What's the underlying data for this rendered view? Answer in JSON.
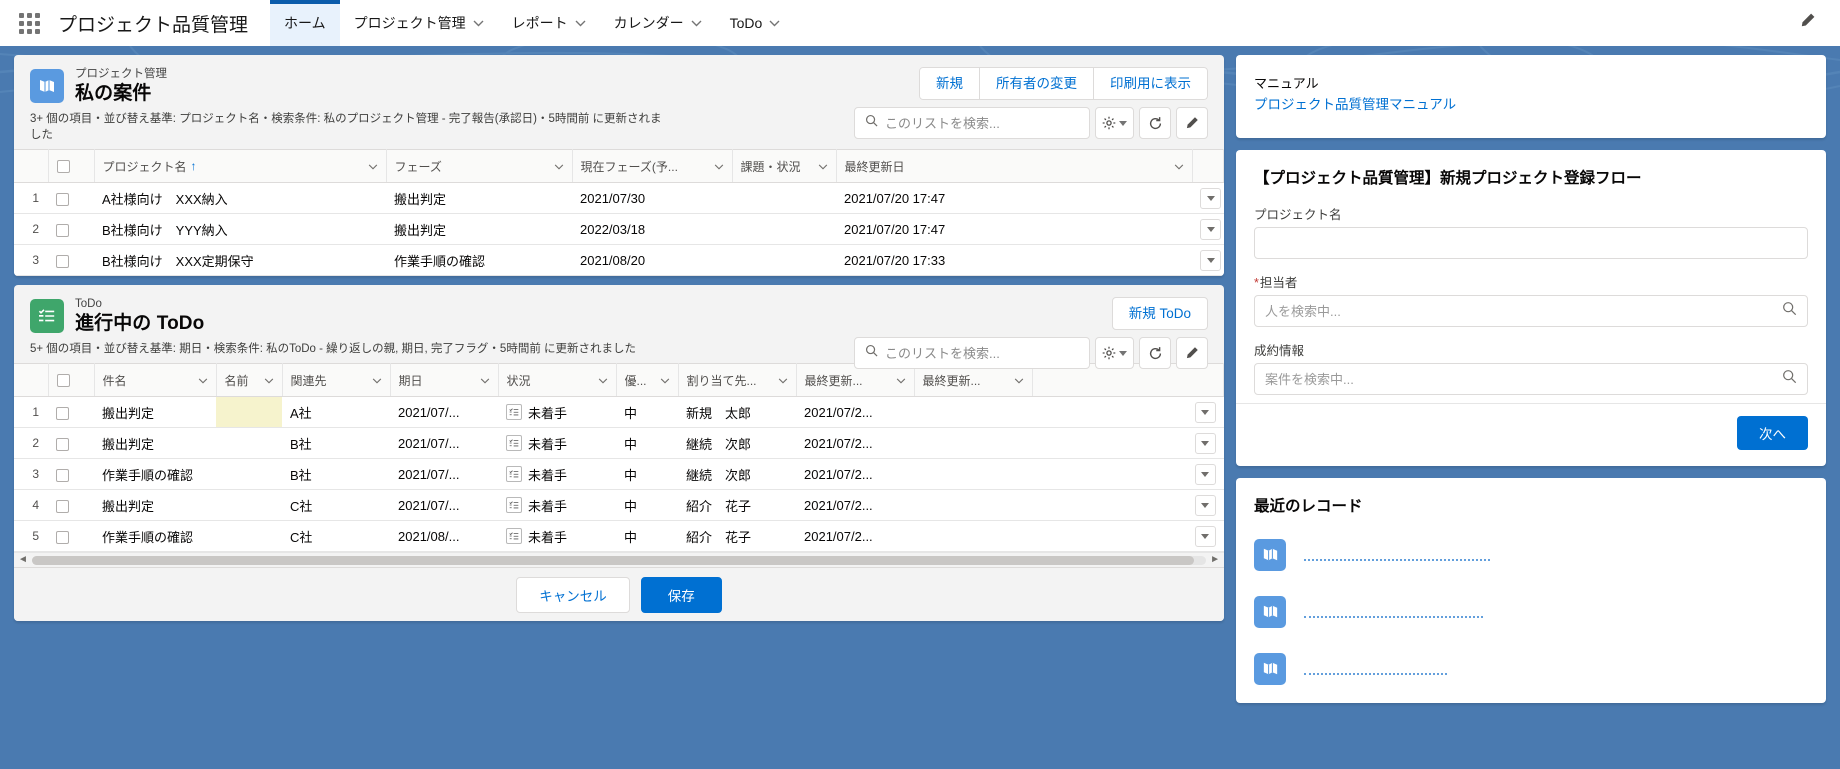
{
  "nav": {
    "app_launcher_icon": "app-launcher-waffle-icon",
    "app_name": "プロジェクト品質管理",
    "items": [
      {
        "label": "ホーム",
        "has_caret": false,
        "active": true
      },
      {
        "label": "プロジェクト管理",
        "has_caret": true,
        "active": false
      },
      {
        "label": "レポート",
        "has_caret": true,
        "active": false
      },
      {
        "label": "カレンダー",
        "has_caret": true,
        "active": false
      },
      {
        "label": "ToDo",
        "has_caret": true,
        "active": false
      }
    ],
    "edit_icon": "pencil-icon"
  },
  "colors": {
    "accent": "#0070d2",
    "link": "#0070d2",
    "nav_active_bar": "#0b5cab",
    "background": "#4a7ab0",
    "project_icon": "#5a9ae0",
    "todo_icon": "#3fa66b",
    "required_mark": "#c23934",
    "highlight_cell": "#f6f3cd"
  },
  "projects_card": {
    "object_label": "プロジェクト管理",
    "title": "私の案件",
    "meta": "3+ 個の項目・並び替え基準: プロジェクト名・検索条件: 私のプロジェクト管理 - 完了報告(承認日)・5時間前 に更新されました",
    "buttons": [
      {
        "label": "新規",
        "name": "new-button"
      },
      {
        "label": "所有者の変更",
        "name": "change-owner-button"
      },
      {
        "label": "印刷用に表示",
        "name": "printable-view-button"
      }
    ],
    "search": {
      "placeholder": "このリストを検索...",
      "value": ""
    },
    "tool_icons": [
      "gear-icon",
      "refresh-icon",
      "pencil-icon"
    ],
    "columns": [
      {
        "label": "プロジェクト名",
        "sorted": true,
        "sort_dir": "↑"
      },
      {
        "label": "フェーズ",
        "sorted": false
      },
      {
        "label": "現在フェーズ(予...",
        "sorted": false
      },
      {
        "label": "課題・状況",
        "sorted": false
      },
      {
        "label": "最終更新日",
        "sorted": false
      }
    ],
    "rows": [
      {
        "n": "1",
        "name_a": "A社様向け",
        "name_b": "XXX納入",
        "phase": "搬出判定",
        "current_phase": "2021/07/30",
        "issue": "",
        "updated": "2021/07/20 17:47"
      },
      {
        "n": "2",
        "name_a": "B社様向け",
        "name_b": "YYY納入",
        "phase": "搬出判定",
        "current_phase": "2022/03/18",
        "issue": "",
        "updated": "2021/07/20 17:47"
      },
      {
        "n": "3",
        "name_a": "B社様向け",
        "name_b": "XXX定期保守",
        "phase": "作業手順の確認",
        "current_phase": "2021/08/20",
        "issue": "",
        "updated": "2021/07/20 17:33"
      }
    ]
  },
  "todo_card": {
    "object_label": "ToDo",
    "title": "進行中の ToDo",
    "meta": "5+ 個の項目・並び替え基準: 期日・検索条件: 私のToDo - 繰り返しの親, 期日, 完了フラグ・5時間前 に更新されました",
    "buttons": [
      {
        "label": "新規 ToDo",
        "name": "new-todo-button"
      }
    ],
    "search": {
      "placeholder": "このリストを検索...",
      "value": ""
    },
    "tool_icons": [
      "gear-icon",
      "refresh-icon",
      "pencil-icon"
    ],
    "columns": [
      {
        "label": "件名"
      },
      {
        "label": "名前"
      },
      {
        "label": "関連先"
      },
      {
        "label": "期日"
      },
      {
        "label": "状況"
      },
      {
        "label": "優..."
      },
      {
        "label": "割り当て先..."
      },
      {
        "label": "最終更新..."
      },
      {
        "label": "最終更新..."
      }
    ],
    "rows": [
      {
        "n": "1",
        "subject": "搬出判定",
        "name": "",
        "related": "A社",
        "due": "2021/07/...",
        "status": "未着手",
        "priority": "中",
        "assign_a": "新規",
        "assign_b": "太郎",
        "updated": "2021/07/2...",
        "highlight_name": true
      },
      {
        "n": "2",
        "subject": "搬出判定",
        "name": "",
        "related": "B社",
        "due": "2021/07/...",
        "status": "未着手",
        "priority": "中",
        "assign_a": "継続",
        "assign_b": "次郎",
        "updated": "2021/07/2...",
        "highlight_name": false
      },
      {
        "n": "3",
        "subject": "作業手順の確認",
        "name": "",
        "related": "B社",
        "due": "2021/07/...",
        "status": "未着手",
        "priority": "中",
        "assign_a": "継続",
        "assign_b": "次郎",
        "updated": "2021/07/2...",
        "highlight_name": false
      },
      {
        "n": "4",
        "subject": "搬出判定",
        "name": "",
        "related": "C社",
        "due": "2021/07/...",
        "status": "未着手",
        "priority": "中",
        "assign_a": "紹介",
        "assign_b": "花子",
        "updated": "2021/07/2...",
        "highlight_name": false
      },
      {
        "n": "5",
        "subject": "作業手順の確認",
        "name": "",
        "related": "C社",
        "due": "2021/08/...",
        "status": "未着手",
        "priority": "中",
        "assign_a": "紹介",
        "assign_b": "花子",
        "updated": "2021/07/2...",
        "highlight_name": false
      }
    ],
    "footer": {
      "cancel_label": "キャンセル",
      "save_label": "保存"
    }
  },
  "manual_panel": {
    "label": "マニュアル",
    "link": "プロジェクト品質管理マニュアル"
  },
  "flow_panel": {
    "title": "【プロジェクト品質管理】新規プロジェクト登録フロー",
    "fields": [
      {
        "label": "プロジェクト名",
        "required": false,
        "placeholder": "",
        "value": "",
        "has_search_icon": false
      },
      {
        "label": "担当者",
        "required": true,
        "placeholder": "人を検索中...",
        "value": "",
        "has_search_icon": true
      },
      {
        "label": "成約情報",
        "required": false,
        "placeholder": "案件を検索中...",
        "value": "",
        "has_search_icon": true
      }
    ],
    "next_label": "次へ"
  },
  "recent_panel": {
    "title": "最近のレコード",
    "items": [
      {
        "icon": "project-icon",
        "link_width": 186,
        "redacted": true
      },
      {
        "icon": "project-icon",
        "link_width": 179,
        "redacted": true
      },
      {
        "icon": "project-icon",
        "link_width": 143,
        "redacted": true
      }
    ]
  }
}
